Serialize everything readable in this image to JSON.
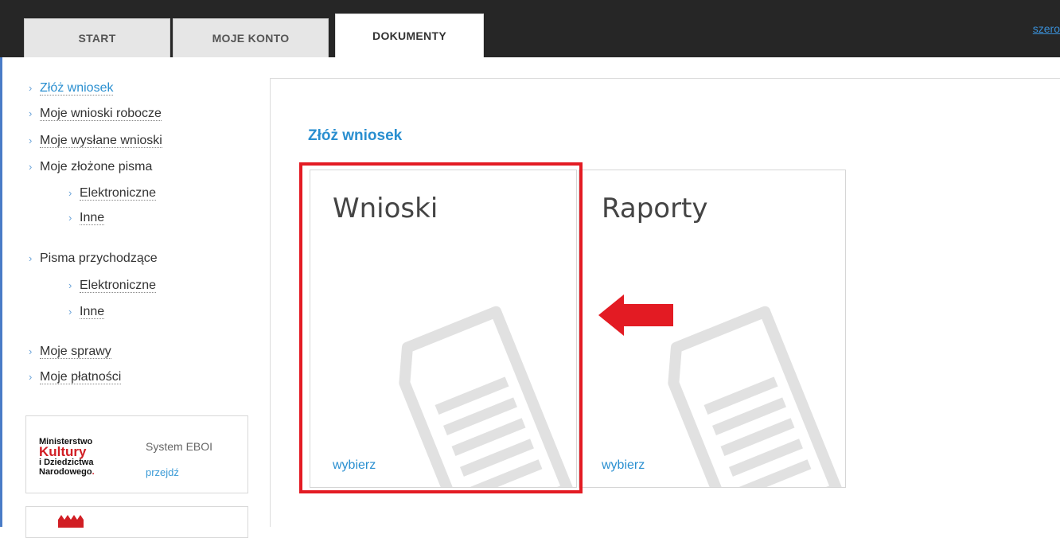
{
  "nav": {
    "tabs": [
      {
        "label": "START"
      },
      {
        "label": "MOJE KONTO"
      },
      {
        "label": "DOKUMENTY"
      }
    ],
    "user_link": "szero"
  },
  "sidebar": {
    "items": [
      {
        "label": "Złóż wniosek"
      },
      {
        "label": "Moje wnioski robocze"
      },
      {
        "label": "Moje wysłane wnioski"
      },
      {
        "label": "Moje złożone pisma"
      },
      {
        "label": "Elektroniczne"
      },
      {
        "label": "Inne"
      },
      {
        "label": "Pisma przychodzące"
      },
      {
        "label": "Elektroniczne"
      },
      {
        "label": "Inne"
      },
      {
        "label": "Moje sprawy"
      },
      {
        "label": "Moje płatności"
      }
    ],
    "promo": {
      "logo_line1": "Ministerstwo",
      "logo_line2": "Kultury",
      "logo_line3": "i Dziedzictwa",
      "logo_line4": "Narodowego",
      "system": "System EBOI",
      "link": "przejdź"
    }
  },
  "main": {
    "title": "Złóż wniosek",
    "tiles": [
      {
        "title": "Wnioski",
        "action": "wybierz"
      },
      {
        "title": "Raporty",
        "action": "wybierz"
      }
    ]
  },
  "colors": {
    "accent": "#2a8fd0",
    "highlight": "#e31b23",
    "topbar": "#262626"
  }
}
